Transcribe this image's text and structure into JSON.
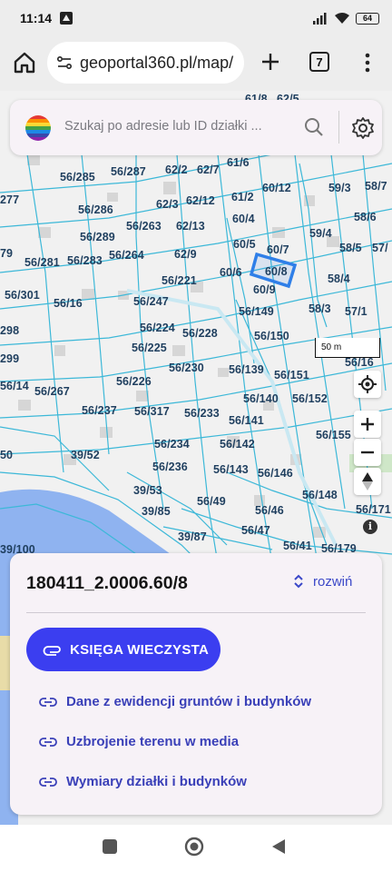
{
  "status": {
    "time": "11:14",
    "battery": "64"
  },
  "browser": {
    "url": "geoportal360.pl/map/",
    "tab_count": "7"
  },
  "search": {
    "placeholder": "Szukaj po adresie lub ID działki ..."
  },
  "map": {
    "scale_label": "50 m",
    "parcels": [
      "61/8",
      "62/5",
      "56/285",
      "56/287",
      "62/2",
      "62/7",
      "61/6",
      "60/12",
      "59/3",
      "58/7",
      "277",
      "62/3",
      "62/12",
      "61/2",
      "56/286",
      "56/263",
      "62/13",
      "60/4",
      "58/6",
      "56/289",
      "59/4",
      "56/264",
      "60/5",
      "60/7",
      "58/5",
      "57/",
      "79",
      "56/281",
      "56/283",
      "62/9",
      "60/6",
      "60/8",
      "56/221",
      "58/4",
      "56/301",
      "56/247",
      "60/9",
      "56/16",
      "56/149",
      "58/3",
      "57/1",
      "298",
      "56/224",
      "56/228",
      "56/225",
      "56/150",
      "299",
      "56/230",
      "56/139",
      "56/151",
      "56/16",
      "56/14",
      "56/226",
      "56/267",
      "56/140",
      "56/152",
      "56/237",
      "56/317",
      "56/233",
      "56/141",
      "56/155",
      "56/234",
      "56/142",
      "39/52",
      "56/236",
      "56/143",
      "56/146",
      "50",
      "39/53",
      "56/49",
      "56/148",
      "39/85",
      "56/46",
      "56/171",
      "39/87",
      "56/47",
      "56/41",
      "56/179",
      "39/100"
    ],
    "selected_parcel": "60/8"
  },
  "sheet": {
    "parcel_id": "180411_2.0006.60/8",
    "expand_label": "rozwiń",
    "kw_button": "KSIĘGA WIECZYSTA",
    "links": [
      "Dane z ewidencji gruntów i budynków",
      "Uzbrojenie terenu w media",
      "Wymiary działki i budynków"
    ]
  },
  "colors": {
    "accent": "#3b3ef0",
    "link": "#3a40b8",
    "parcel_line": "#3cb8d8",
    "selection": "#2f7fe8",
    "water": "#8fb3f0"
  }
}
